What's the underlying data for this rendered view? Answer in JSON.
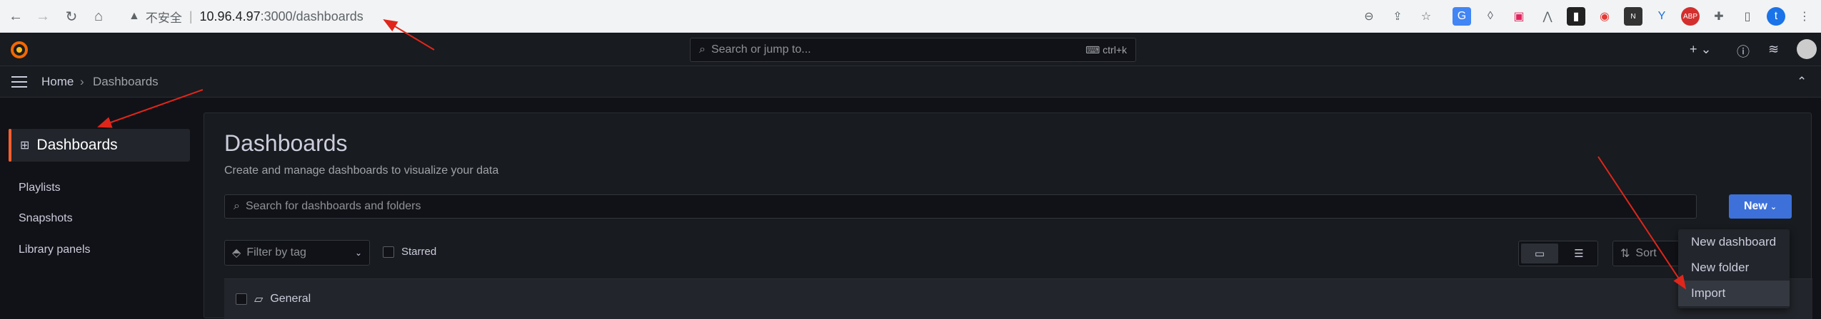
{
  "browser": {
    "security_label": "不安全",
    "url_host": "10.96.4.97",
    "url_rest": ":3000/dashboards"
  },
  "topbar": {
    "search_placeholder": "Search or jump to...",
    "search_shortcut": "ctrl+k"
  },
  "breadcrumb": {
    "home": "Home",
    "current": "Dashboards"
  },
  "sidebar": {
    "active": "Dashboards",
    "items": [
      "Playlists",
      "Snapshots",
      "Library panels"
    ]
  },
  "main": {
    "title": "Dashboards",
    "subtitle": "Create and manage dashboards to visualize your data",
    "search_placeholder": "Search for dashboards and folders",
    "new_label": "New",
    "tag_filter_placeholder": "Filter by tag",
    "starred_label": "Starred",
    "sort_label": "Sort",
    "folder_name": "General"
  },
  "new_menu": {
    "items": [
      "New dashboard",
      "New folder",
      "Import"
    ]
  },
  "colors": {
    "accent": "#ff5f2e",
    "primary_button": "#3d71d9",
    "annotation_arrow": "#e0261b"
  }
}
